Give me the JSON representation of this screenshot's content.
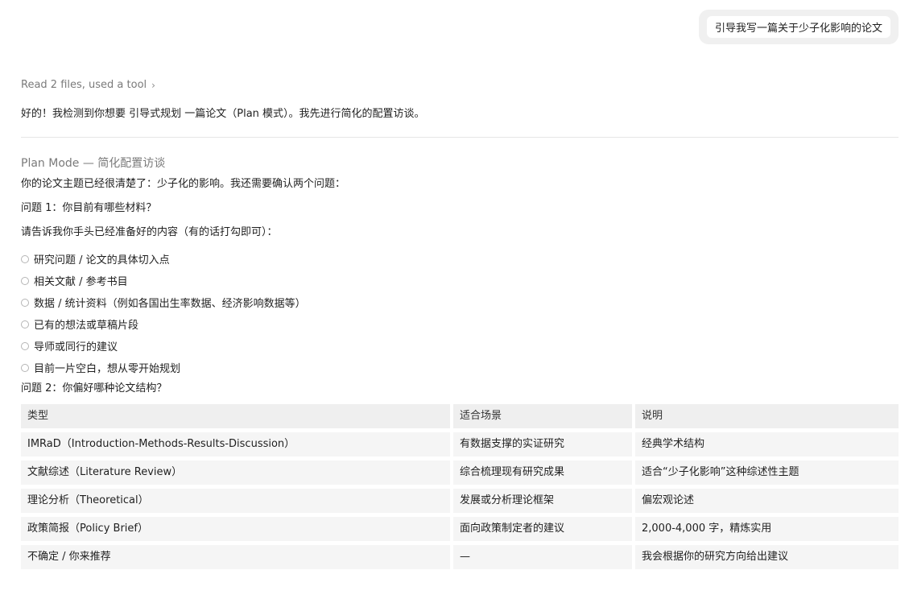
{
  "user_message": "引导我写一篇关于少子化影响的论文",
  "tool_summary": {
    "label": "Read 2 files, used a tool",
    "chevron": "›"
  },
  "intro": "好的！我检测到你想要 引导式规划 一篇论文（Plan 模式）。我先进行简化的配置访谈。",
  "section": {
    "title": "Plan Mode — 简化配置访谈",
    "topic_line": "你的论文主题已经很清楚了：少子化的影响。我还需要确认两个问题：",
    "q1_title": "问题 1：你目前有哪些材料？",
    "q1_prompt": "请告诉我你手头已经准备好的内容（有的话打勾即可）：",
    "options": [
      "研究问题 / 论文的具体切入点",
      "相关文献 / 参考书目",
      "数据 / 统计资料（例如各国出生率数据、经济影响数据等）",
      "已有的想法或草稿片段",
      "导师或同行的建议",
      "目前一片空白，想从零开始规划"
    ],
    "q2_title": "问题 2：你偏好哪种论文结构？",
    "table": {
      "headers": [
        "类型",
        "适合场景",
        "说明"
      ],
      "rows": [
        [
          "IMRaD（Introduction-Methods-Results-Discussion）",
          "有数据支撑的实证研究",
          "经典学术结构"
        ],
        [
          "文献综述（Literature Review）",
          "综合梳理现有研究成果",
          "适合“少子化影响”这种综述性主题"
        ],
        [
          "理论分析（Theoretical）",
          "发展或分析理论框架",
          "偏宏观论述"
        ],
        [
          "政策简报（Policy Brief）",
          "面向政策制定者的建议",
          "2,000-4,000 字，精炼实用"
        ],
        [
          "不确定 / 你来推荐",
          "—",
          "我会根据你的研究方向给出建议"
        ]
      ]
    }
  }
}
